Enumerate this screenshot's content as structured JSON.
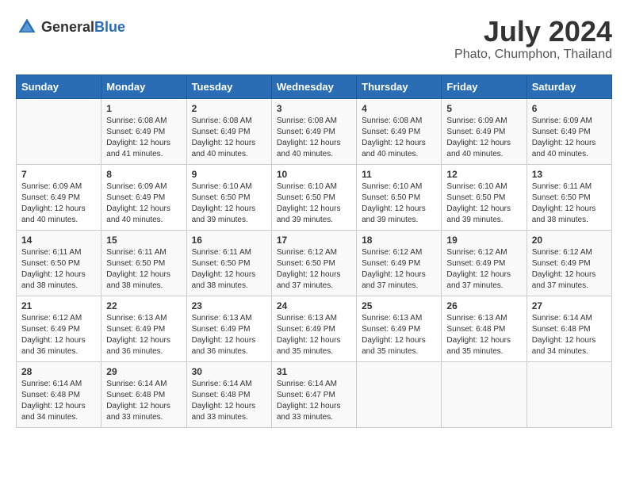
{
  "logo": {
    "general": "General",
    "blue": "Blue"
  },
  "header": {
    "month": "July 2024",
    "location": "Phato, Chumphon, Thailand"
  },
  "weekdays": [
    "Sunday",
    "Monday",
    "Tuesday",
    "Wednesday",
    "Thursday",
    "Friday",
    "Saturday"
  ],
  "weeks": [
    [
      {
        "day": "",
        "info": ""
      },
      {
        "day": "1",
        "info": "Sunrise: 6:08 AM\nSunset: 6:49 PM\nDaylight: 12 hours\nand 41 minutes."
      },
      {
        "day": "2",
        "info": "Sunrise: 6:08 AM\nSunset: 6:49 PM\nDaylight: 12 hours\nand 40 minutes."
      },
      {
        "day": "3",
        "info": "Sunrise: 6:08 AM\nSunset: 6:49 PM\nDaylight: 12 hours\nand 40 minutes."
      },
      {
        "day": "4",
        "info": "Sunrise: 6:08 AM\nSunset: 6:49 PM\nDaylight: 12 hours\nand 40 minutes."
      },
      {
        "day": "5",
        "info": "Sunrise: 6:09 AM\nSunset: 6:49 PM\nDaylight: 12 hours\nand 40 minutes."
      },
      {
        "day": "6",
        "info": "Sunrise: 6:09 AM\nSunset: 6:49 PM\nDaylight: 12 hours\nand 40 minutes."
      }
    ],
    [
      {
        "day": "7",
        "info": ""
      },
      {
        "day": "8",
        "info": "Sunrise: 6:09 AM\nSunset: 6:49 PM\nDaylight: 12 hours\nand 40 minutes."
      },
      {
        "day": "9",
        "info": "Sunrise: 6:10 AM\nSunset: 6:50 PM\nDaylight: 12 hours\nand 39 minutes."
      },
      {
        "day": "10",
        "info": "Sunrise: 6:10 AM\nSunset: 6:50 PM\nDaylight: 12 hours\nand 39 minutes."
      },
      {
        "day": "11",
        "info": "Sunrise: 6:10 AM\nSunset: 6:50 PM\nDaylight: 12 hours\nand 39 minutes."
      },
      {
        "day": "12",
        "info": "Sunrise: 6:10 AM\nSunset: 6:50 PM\nDaylight: 12 hours\nand 39 minutes."
      },
      {
        "day": "13",
        "info": "Sunrise: 6:11 AM\nSunset: 6:50 PM\nDaylight: 12 hours\nand 38 minutes."
      }
    ],
    [
      {
        "day": "14",
        "info": ""
      },
      {
        "day": "15",
        "info": "Sunrise: 6:11 AM\nSunset: 6:50 PM\nDaylight: 12 hours\nand 38 minutes."
      },
      {
        "day": "16",
        "info": "Sunrise: 6:11 AM\nSunset: 6:50 PM\nDaylight: 12 hours\nand 38 minutes."
      },
      {
        "day": "17",
        "info": "Sunrise: 6:12 AM\nSunset: 6:50 PM\nDaylight: 12 hours\nand 37 minutes."
      },
      {
        "day": "18",
        "info": "Sunrise: 6:12 AM\nSunset: 6:49 PM\nDaylight: 12 hours\nand 37 minutes."
      },
      {
        "day": "19",
        "info": "Sunrise: 6:12 AM\nSunset: 6:49 PM\nDaylight: 12 hours\nand 37 minutes."
      },
      {
        "day": "20",
        "info": "Sunrise: 6:12 AM\nSunset: 6:49 PM\nDaylight: 12 hours\nand 37 minutes."
      }
    ],
    [
      {
        "day": "21",
        "info": ""
      },
      {
        "day": "22",
        "info": "Sunrise: 6:13 AM\nSunset: 6:49 PM\nDaylight: 12 hours\nand 36 minutes."
      },
      {
        "day": "23",
        "info": "Sunrise: 6:13 AM\nSunset: 6:49 PM\nDaylight: 12 hours\nand 36 minutes."
      },
      {
        "day": "24",
        "info": "Sunrise: 6:13 AM\nSunset: 6:49 PM\nDaylight: 12 hours\nand 35 minutes."
      },
      {
        "day": "25",
        "info": "Sunrise: 6:13 AM\nSunset: 6:49 PM\nDaylight: 12 hours\nand 35 minutes."
      },
      {
        "day": "26",
        "info": "Sunrise: 6:13 AM\nSunset: 6:48 PM\nDaylight: 12 hours\nand 35 minutes."
      },
      {
        "day": "27",
        "info": "Sunrise: 6:14 AM\nSunset: 6:48 PM\nDaylight: 12 hours\nand 34 minutes."
      }
    ],
    [
      {
        "day": "28",
        "info": "Sunrise: 6:14 AM\nSunset: 6:48 PM\nDaylight: 12 hours\nand 34 minutes."
      },
      {
        "day": "29",
        "info": "Sunrise: 6:14 AM\nSunset: 6:48 PM\nDaylight: 12 hours\nand 33 minutes."
      },
      {
        "day": "30",
        "info": "Sunrise: 6:14 AM\nSunset: 6:48 PM\nDaylight: 12 hours\nand 33 minutes."
      },
      {
        "day": "31",
        "info": "Sunrise: 6:14 AM\nSunset: 6:47 PM\nDaylight: 12 hours\nand 33 minutes."
      },
      {
        "day": "",
        "info": ""
      },
      {
        "day": "",
        "info": ""
      },
      {
        "day": "",
        "info": ""
      }
    ]
  ],
  "week7_sunday_info": "Sunrise: 6:09 AM\nSunset: 6:49 PM\nDaylight: 12 hours\nand 40 minutes.",
  "week14_sunday_info": "Sunrise: 6:11 AM\nSunset: 6:50 PM\nDaylight: 12 hours\nand 38 minutes.",
  "week21_sunday_info": "Sunrise: 6:12 AM\nSunset: 6:49 PM\nDaylight: 12 hours\nand 36 minutes."
}
